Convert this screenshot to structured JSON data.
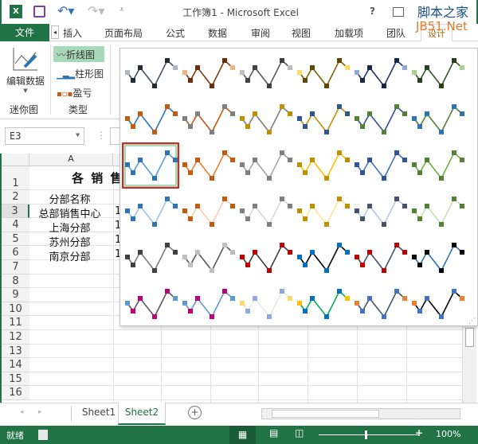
{
  "titlebar": {
    "title": "工作簿1 - Microsoft Excel",
    "help": "?",
    "logo_top": "脚本之家",
    "logo_bottom": "JB51.Net"
  },
  "tabs": {
    "file": "文件",
    "items": [
      "插入",
      "页面布局",
      "公式",
      "数据",
      "审阅",
      "视图",
      "加载项",
      "团队",
      "设计"
    ]
  },
  "ribbon": {
    "edit_data": "编辑数据",
    "group_sparkline": "迷你图",
    "line": "折线图",
    "column": "柱形图",
    "winloss": "盈亏",
    "group_type": "类型"
  },
  "namebox": {
    "value": "E3"
  },
  "grid": {
    "col_a": "A",
    "rows": [
      "1",
      "2",
      "3",
      "4",
      "5",
      "6",
      "7",
      "8",
      "9",
      "10",
      "11",
      "12",
      "13",
      "14",
      "15",
      "16"
    ],
    "cells": [
      "各 销 售",
      "分部名称",
      "总部销售中心",
      "上海分部",
      "苏州分部",
      "南京分部"
    ],
    "col_b_partial": [
      "1",
      "1",
      "1",
      "1"
    ]
  },
  "gallery": {
    "styles": [
      [
        "#44546a",
        "#222a35",
        "#adb9ca"
      ],
      [
        "#843c0c",
        "#6a2e0a",
        "#f4b183"
      ],
      [
        "#595959",
        "#404040",
        "#bfbfbf"
      ],
      [
        "#7f6000",
        "#5e4700",
        "#ffd966"
      ],
      [
        "#1f3864",
        "#16284a",
        "#8faadc"
      ],
      [
        "#385723",
        "#29411a",
        "#a9d18e"
      ],
      [
        "#2e75b6",
        "#c55a11",
        "#c55a11"
      ],
      [
        "#c55a11",
        "#7f7f7f",
        "#7f7f7f"
      ],
      [
        "#7f7f7f",
        "#bf9000",
        "#bf9000"
      ],
      [
        "#bf9000",
        "#2f5597",
        "#2f5597"
      ],
      [
        "#2f5597",
        "#548235",
        "#548235"
      ],
      [
        "#548235",
        "#2e75b6",
        "#2e75b6"
      ],
      [
        "#5b9bd5",
        "#2e75b6",
        "#2e75b6"
      ],
      [
        "#ed7d31",
        "#c55a11",
        "#c55a11"
      ],
      [
        "#a5a5a5",
        "#7f7f7f",
        "#7f7f7f"
      ],
      [
        "#ffc000",
        "#bf9000",
        "#bf9000"
      ],
      [
        "#4472c4",
        "#2f5597",
        "#2f5597"
      ],
      [
        "#70ad47",
        "#548235",
        "#548235"
      ],
      [
        "#9dc3e6",
        "#2e75b6",
        "#2e75b6"
      ],
      [
        "#f8cbad",
        "#c55a11",
        "#c55a11"
      ],
      [
        "#d9d9d9",
        "#7f7f7f",
        "#7f7f7f"
      ],
      [
        "#ffe699",
        "#bf9000",
        "#bf9000"
      ],
      [
        "#b4c7e7",
        "#44546a",
        "#44546a"
      ],
      [
        "#c5e0b4",
        "#548235",
        "#548235"
      ],
      [
        "#7f7f7f",
        "#404040",
        "#404040"
      ],
      [
        "#595959",
        "#bfbfbf",
        "#bfbfbf"
      ],
      [
        "#404040",
        "#c00000",
        "#c00000"
      ],
      [
        "#000000",
        "#0070c0",
        "#0070c0"
      ],
      [
        "#44546a",
        "#c00000",
        "#c00000"
      ],
      [
        "#2e75b6",
        "#000000",
        "#000000"
      ],
      [
        "#595959",
        "#c00078",
        "#5b9bd5"
      ],
      [
        "#5b9bd5",
        "#c00078",
        "#5b9bd5"
      ],
      [
        "#e2efda",
        "#8faadc",
        "#ffd966"
      ],
      [
        "#00b050",
        "#0070c0",
        "#ffc000"
      ],
      [
        "#44546a",
        "#4472c4",
        "#ed7d31"
      ],
      [
        "#000000",
        "#4472c4",
        "#ed7d31"
      ]
    ],
    "selected_index": 12
  },
  "sheets": {
    "tabs": [
      "Sheet1",
      "Sheet2"
    ],
    "active": "Sheet2"
  },
  "status": {
    "ready": "就绪",
    "zoom": "100%"
  },
  "colors": {
    "brand": "#217346",
    "selection": "#d9251d"
  }
}
